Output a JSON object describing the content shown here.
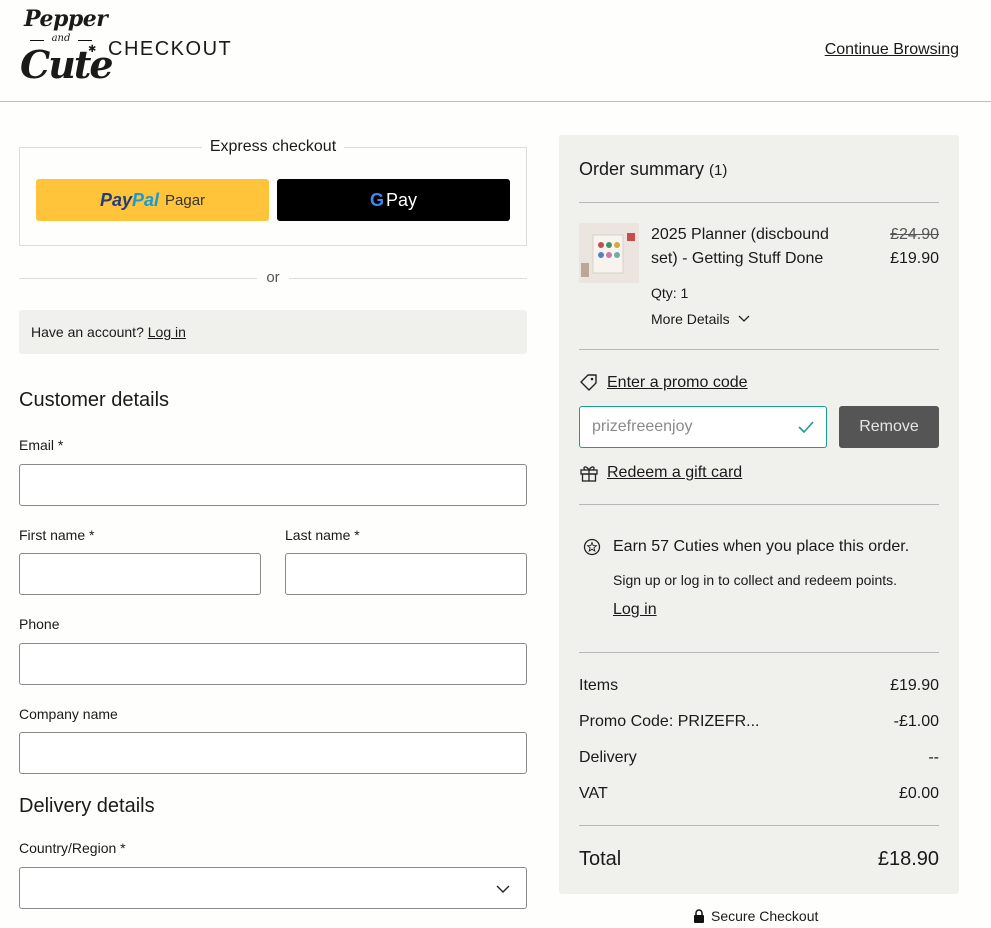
{
  "header": {
    "logo_line1": "Pepper",
    "logo_line2": "and",
    "logo_line3": "Cute",
    "title": "CHECKOUT",
    "continue_label": "Continue Browsing"
  },
  "express": {
    "title": "Express checkout",
    "paypal_pay": "Pay",
    "paypal_pal": "Pal",
    "paypal_label": "Pagar",
    "gpay_g": "G",
    "gpay_label": "Pay"
  },
  "or_label": "or",
  "account": {
    "prompt": "Have an account?",
    "login_label": "Log in"
  },
  "customer": {
    "title": "Customer details",
    "email_label": "Email *",
    "first_name_label": "First name *",
    "last_name_label": "Last name *",
    "phone_label": "Phone",
    "company_label": "Company name"
  },
  "delivery": {
    "title": "Delivery details",
    "country_label": "Country/Region *"
  },
  "summary": {
    "title": "Order summary",
    "count": "(1)",
    "item": {
      "name": "2025 Planner (discbound set) - Getting Stuff Done",
      "old_price": "£24.90",
      "new_price": "£19.90",
      "qty": "Qty: 1",
      "more_details": "More Details"
    },
    "promo_link": "Enter a promo code",
    "promo_value": "prizefreeenjoy",
    "remove_label": "Remove",
    "gift_label": "Redeem a gift card",
    "earn_text": "Earn 57 Cuties when you place this order.",
    "earn_sub": "Sign up or log in to collect and redeem points.",
    "earn_login": "Log in",
    "rows": [
      {
        "label": "Items",
        "value": "£19.90"
      },
      {
        "label": "Promo Code: PRIZEFR...",
        "value": "-£1.00"
      },
      {
        "label": "Delivery",
        "value": "--"
      },
      {
        "label": "VAT",
        "value": "£0.00"
      }
    ],
    "total_label": "Total",
    "total_value": "£18.90"
  },
  "secure_label": "Secure Checkout",
  "colors": {
    "paypal_yellow": "#ffc43a",
    "promo_accent": "#1a9c8f",
    "panel_bg": "#f0f0ed"
  },
  "icons": [
    "tag-icon",
    "gift-icon",
    "check-icon",
    "chevron-down-icon",
    "cuties-badge-icon",
    "lock-icon"
  ]
}
